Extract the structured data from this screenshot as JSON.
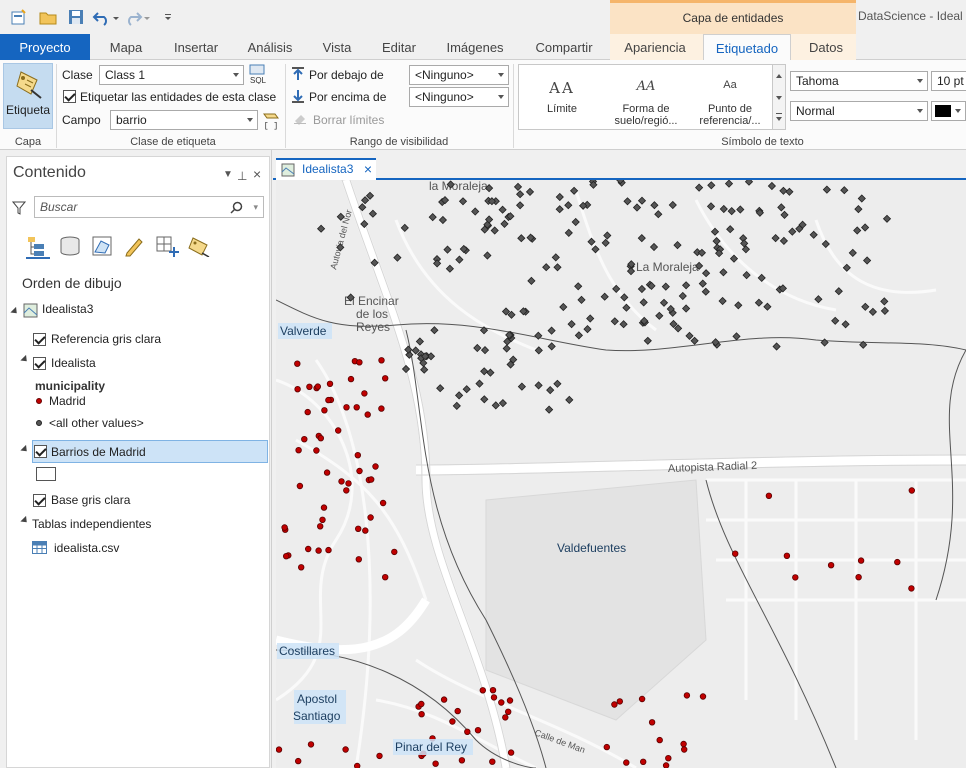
{
  "window": {
    "title_right": "DataScience - Ideal",
    "context_group": "Capa de entidades"
  },
  "tabs": [
    {
      "label": "Proyecto"
    },
    {
      "label": "Mapa"
    },
    {
      "label": "Insertar"
    },
    {
      "label": "Análisis"
    },
    {
      "label": "Vista"
    },
    {
      "label": "Editar"
    },
    {
      "label": "Imágenes"
    },
    {
      "label": "Compartir"
    },
    {
      "label": "Apariencia"
    },
    {
      "label": "Etiquetado"
    },
    {
      "label": "Datos"
    }
  ],
  "ribbon": {
    "layer_group": {
      "button": "Etiqueta",
      "group_label": "Capa"
    },
    "label_class": {
      "class_label": "Clase",
      "class_value": "Class 1",
      "sql_label": "SQL",
      "checkbox_label": "Etiquetar las entidades de esta clase",
      "checkbox_checked": true,
      "field_label": "Campo",
      "field_value": "barrio",
      "group_label": "Clase de etiqueta"
    },
    "visibility": {
      "below_label": "Por debajo de",
      "below_value": "<Ninguno>",
      "above_label": "Por encima de",
      "above_value": "<Ninguno>",
      "clear_label": "Borrar límites",
      "group_label": "Rango de visibilidad"
    },
    "text_symbol": {
      "gallery": [
        {
          "glyph": "AA",
          "label": "Límite"
        },
        {
          "glyph": "AA",
          "label": "Forma de suelo/regió..."
        },
        {
          "glyph": "Aa",
          "label": "Punto de referencia/..."
        }
      ],
      "font": "Tahoma",
      "size": "10 pt",
      "style": "Normal",
      "color": "#000000",
      "group_label": "Símbolo de texto"
    }
  },
  "contents": {
    "title": "Contenido",
    "search_placeholder": "Buscar",
    "draw_order": "Orden de dibujo",
    "map": "Idealista3",
    "layers": {
      "referencia": "Referencia gris clara",
      "idealista": "Idealista",
      "field": "municipality",
      "madrid": "Madrid",
      "others": "<all other values>",
      "barrios": "Barrios de Madrid",
      "base": "Base gris clara"
    },
    "tables_group": "Tablas independientes",
    "table": "idealista.csv"
  },
  "map_view": {
    "tab_title": "Idealista3",
    "place_names": {
      "moraleja_top": "la Moraleja",
      "moraleja": "La Moraleja",
      "encinar": [
        "El Encinar",
        "de los",
        "Reyes"
      ],
      "autovia": "Autovia del Nor",
      "autopista": "Autopista Radial 2",
      "calle": "Calle de Man"
    },
    "barrio_labels": {
      "valverde": "Valverde",
      "valdefuentes": "Valdefuentes",
      "costillares": "Costillares",
      "apostol": [
        "Apostol",
        "Santiago"
      ],
      "pinar": "Pinar del Rey"
    },
    "colors": {
      "madrid_point": "#c00000",
      "other_point": "#555555",
      "label_halo": "#cde3f7"
    }
  }
}
